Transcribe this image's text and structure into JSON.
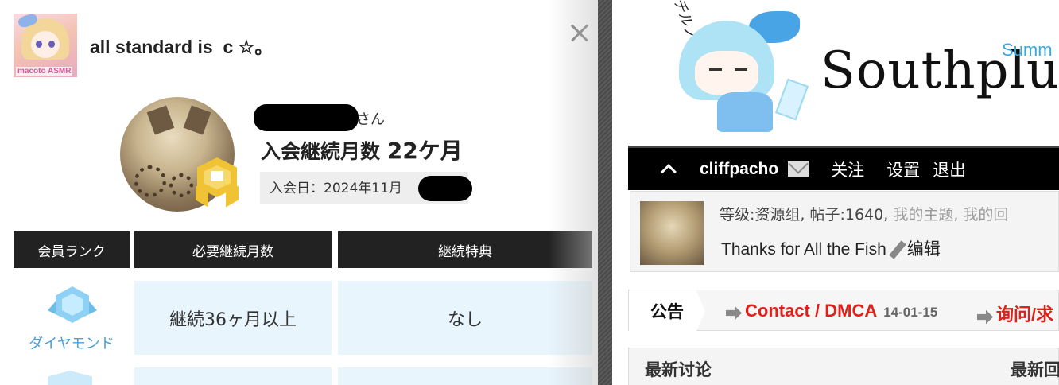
{
  "left_panel": {
    "creator": {
      "name": "all standard is  c ☆。",
      "avatar_tag": "macoto ASMR"
    },
    "close_icon": "close-icon",
    "member": {
      "honorific": "さん",
      "months_label": "入会継続月数",
      "months_value": "22ケ月",
      "join_date": "入会日：2024年11月",
      "badge_icon": "gold-book-badge-icon"
    },
    "table": {
      "headers": [
        "会員ランク",
        "必要継続月数",
        "継続特典"
      ],
      "rows": [
        {
          "rank": "ダイヤモンド",
          "rank_icon": "diamond-rank-icon",
          "required": "継続36ヶ月以上",
          "benefit": "なし"
        }
      ]
    },
    "colors": {
      "header_bg": "#222222",
      "cell_bg": "#e8f5fd",
      "rank_text": "#4a9fd8"
    }
  },
  "right_panel": {
    "logo": {
      "text": "Southplus",
      "sub": "Summ"
    },
    "mascot_scribble": "チルノ",
    "navbar": {
      "username": "cliffpacho",
      "links": [
        "关注",
        "设置",
        "退出"
      ]
    },
    "profile": {
      "level_text": "等级:资源组, 帖子:1640, ",
      "muted_links": "我的主题, 我的回",
      "signature": "Thanks for All the Fish",
      "edit_label": "编辑"
    },
    "notice": {
      "label": "公告",
      "items": [
        {
          "text": "Contact / DMCA",
          "date": "14-01-15"
        },
        {
          "text": "询问/求"
        }
      ]
    },
    "latest": {
      "title": "最新讨论",
      "right_title": "最新回"
    },
    "colors": {
      "notice_link": "#e0201a",
      "logo_sub": "#39a7e0"
    }
  }
}
